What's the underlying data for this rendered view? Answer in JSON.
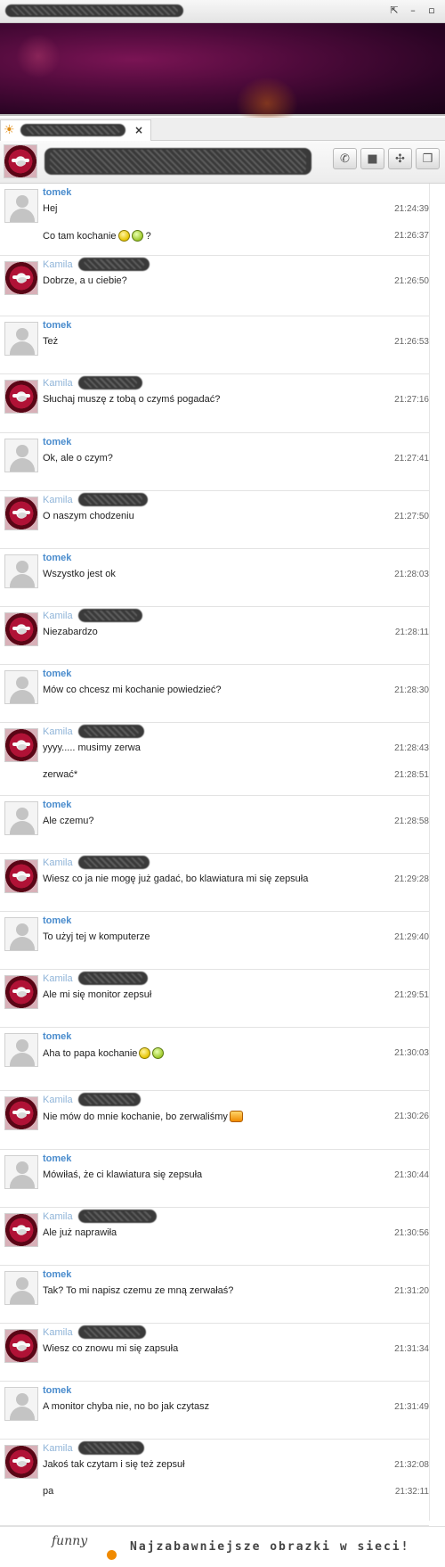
{
  "window": {
    "restore_icon": "restore-icon",
    "minimize_label": "–",
    "close_label": "▫"
  },
  "tab": {
    "close_label": "×"
  },
  "actions": [
    {
      "icon": "phone-icon",
      "glyph": "✆"
    },
    {
      "icon": "video-icon",
      "glyph": "■"
    },
    {
      "icon": "game-icon",
      "glyph": "✣"
    },
    {
      "icon": "gift-icon",
      "glyph": "❒"
    }
  ],
  "messages": [
    {
      "sender": "tomek",
      "lines": [
        {
          "text": "Hej",
          "time": "21:24:39"
        },
        {
          "text": "Co tam kochanie",
          "emoji": [
            "yellow",
            "green"
          ],
          "suffix": " ?",
          "time": "21:26:37"
        }
      ]
    },
    {
      "sender": "Kamila",
      "lines": [
        {
          "text": "Dobrze, a u ciebie?",
          "time": "21:26:50"
        }
      ]
    },
    {
      "sender": "tomek",
      "lines": [
        {
          "text": "Też",
          "time": "21:26:53"
        }
      ]
    },
    {
      "sender": "Kamila",
      "lines": [
        {
          "text": "Słuchaj muszę z tobą o czymś pogadać?",
          "time": "21:27:16"
        }
      ]
    },
    {
      "sender": "tomek",
      "lines": [
        {
          "text": "Ok, ale o czym?",
          "time": "21:27:41"
        }
      ]
    },
    {
      "sender": "Kamila",
      "lines": [
        {
          "text": "O naszym chodzeniu",
          "time": "21:27:50"
        }
      ]
    },
    {
      "sender": "tomek",
      "lines": [
        {
          "text": "Wszystko jest ok",
          "time": "21:28:03"
        }
      ]
    },
    {
      "sender": "Kamila",
      "lines": [
        {
          "text": "Niezabardzo",
          "time": "21:28:11"
        }
      ]
    },
    {
      "sender": "tomek",
      "lines": [
        {
          "text": "Mów co chcesz mi kochanie powiedzieć?",
          "time": "21:28:30"
        }
      ]
    },
    {
      "sender": "Kamila",
      "lines": [
        {
          "text": "yyyy..... musimy zerwa",
          "time": "21:28:43"
        },
        {
          "text": "zerwać*",
          "time": "21:28:51"
        }
      ]
    },
    {
      "sender": "tomek",
      "lines": [
        {
          "text": "Ale czemu?",
          "time": "21:28:58"
        }
      ]
    },
    {
      "sender": "Kamila",
      "lines": [
        {
          "text": "Wiesz co ja nie mogę już gadać, bo klawiatura mi się zepsuła",
          "time": "21:29:28"
        }
      ]
    },
    {
      "sender": "tomek",
      "lines": [
        {
          "text": "To użyj tej w komputerze",
          "time": "21:29:40"
        }
      ]
    },
    {
      "sender": "Kamila",
      "lines": [
        {
          "text": "Ale mi się monitor zepsuł",
          "time": "21:29:51"
        }
      ]
    },
    {
      "sender": "tomek",
      "lines": [
        {
          "text": "Aha to papa kochanie",
          "emoji": [
            "yellow",
            "green"
          ],
          "time": "21:30:03"
        }
      ]
    },
    {
      "sender": "Kamila",
      "lines": [
        {
          "text": "Nie mów do mnie kochanie, bo zerwaliśmy",
          "emoji": [
            "orange"
          ],
          "time": "21:30:26"
        }
      ]
    },
    {
      "sender": "tomek",
      "lines": [
        {
          "text": "Mówiłaś, że ci klawiatura się zepsuła",
          "time": "21:30:44"
        }
      ]
    },
    {
      "sender": "Kamila",
      "lines": [
        {
          "text": "Ale już naprawiła",
          "time": "21:30:56"
        }
      ]
    },
    {
      "sender": "tomek",
      "lines": [
        {
          "text": "Tak? To mi napisz czemu ze mną zerwałaś?",
          "time": "21:31:20"
        }
      ]
    },
    {
      "sender": "Kamila",
      "lines": [
        {
          "text": "Wiesz co znowu mi się zapsuła",
          "time": "21:31:34"
        }
      ]
    },
    {
      "sender": "tomek",
      "lines": [
        {
          "text": "A monitor chyba nie, no bo jak czytasz",
          "time": "21:31:49"
        }
      ]
    },
    {
      "sender": "Kamila",
      "lines": [
        {
          "text": "Jakoś tak czytam i się też zepsuł",
          "time": "21:32:08"
        },
        {
          "text": "pa",
          "time": "21:32:11"
        }
      ]
    }
  ],
  "footer": {
    "logo": "funny",
    "tagline": "Najzabawniejsze obrazki w sieci!"
  }
}
